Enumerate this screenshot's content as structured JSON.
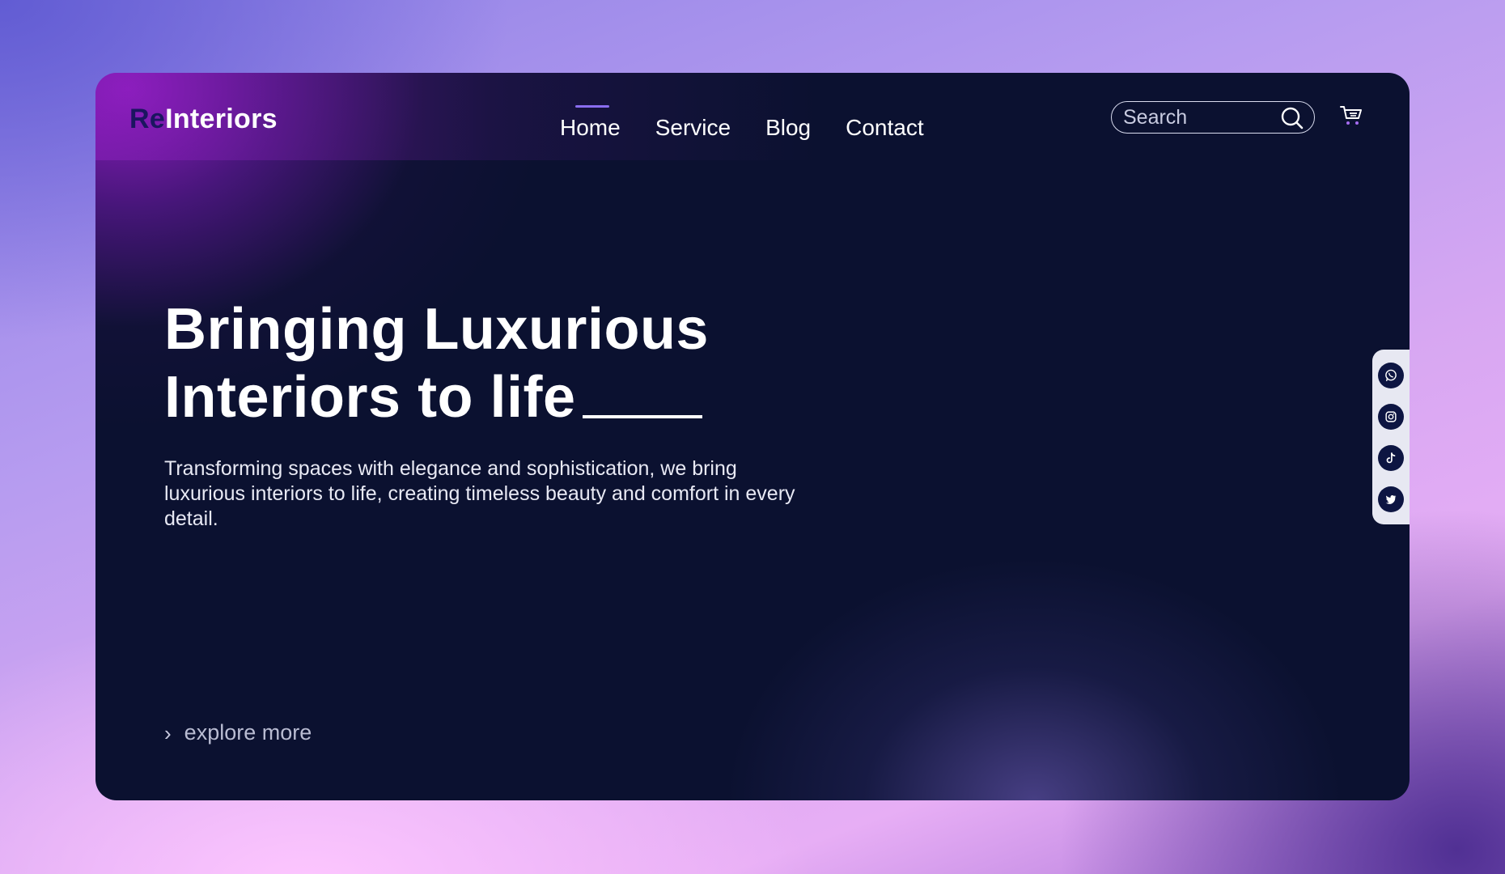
{
  "brand": {
    "logo_prefix": "Re",
    "logo_suffix": "Interiors"
  },
  "nav": {
    "items": [
      {
        "label": "Home",
        "active": true
      },
      {
        "label": "Service"
      },
      {
        "label": "Blog"
      },
      {
        "label": "Contact"
      }
    ]
  },
  "search": {
    "placeholder": "Search",
    "icon": "search-icon"
  },
  "cart": {
    "icon": "cart-icon"
  },
  "hero": {
    "title_line1": "Bringing Luxurious",
    "title_line2": "Interiors to life",
    "description": "Transforming spaces with elegance and sophistication, we bring luxurious interiors to life, creating timeless beauty and comfort in every detail.",
    "cta": "explore more",
    "cta_icon": "chevron-right-icon"
  },
  "social": {
    "icons": [
      "whatsapp-icon",
      "instagram-icon",
      "tiktok-icon",
      "twitter-icon"
    ]
  },
  "colors": {
    "card_background": "#0b1130",
    "accent_purple": "#8a6df0",
    "logo_prefix": "#1b1560",
    "social_bar": "#e7e8f2",
    "social_button": "#0d1542"
  }
}
